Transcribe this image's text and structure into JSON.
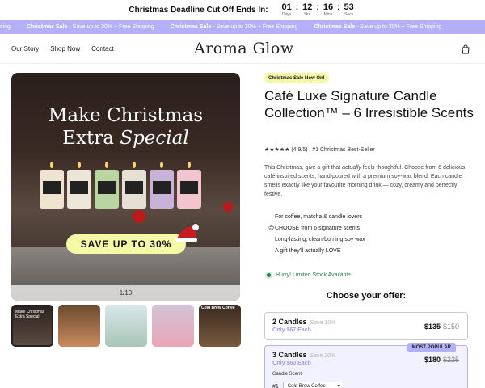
{
  "countdown": {
    "title": "Christmas Deadline Cut Off Ends In:",
    "days": "01",
    "hours": "12",
    "mins": "16",
    "secs": "53",
    "days_label": "Days",
    "hours_label": "Hrs",
    "mins_label": "Mins",
    "secs_label": "Secs"
  },
  "marquee": {
    "lead_fragment": "sing",
    "items": [
      {
        "bold": "Christmas Sale",
        "text": " - Save up to 30% + Free Shipping"
      },
      {
        "bold": "Christmas Sale",
        "text": " - Save up to 30% + Free Shipping"
      },
      {
        "bold": "Christmas Sale",
        "text": " - Save up to 30% + Free Shipping"
      }
    ]
  },
  "header": {
    "nav": [
      "Our Story",
      "Shop Now",
      "Contact"
    ],
    "logo": "Aroma Glow",
    "cart_icon": "bag-icon"
  },
  "gallery": {
    "hero_line1": "Make Christmas",
    "hero_line2_plain": "Extra ",
    "hero_line2_italic": "Special",
    "save_text": "SAVE UP TO 30%",
    "counter": "1/10",
    "thumb1_text": "Make Christmas Extra Special",
    "thumb5_label": "Cold Brew Coffee"
  },
  "product": {
    "badge": "Christmas Sale Now On!",
    "title": "Café Luxe Signature Candle Collection™ – 6 Irresistible Scents",
    "rating": "★★★★★ (4.9/5) | #1 Christmas Best-Seller",
    "desc_1": "This Christmas, give a gift that ",
    "desc_italic": "actually",
    "desc_2": " feels thoughtful. Choose from 6 delicious café-inspired scents, hand-poured with a premium soy-wax blend. Each candle smells exactly like your favourite morning drink — cozy, creamy and perfectly festive.",
    "features": [
      {
        "icon": "",
        "text": "For coffee, matcha & candle lovers"
      },
      {
        "icon": "😊",
        "text": "CHOOSE from 6 signature scents"
      },
      {
        "icon": "",
        "text": "Long-lasting, clean-burning soy wax"
      },
      {
        "icon": "",
        "text": "A gift they'll actually LOVE"
      }
    ],
    "stock": "Hurry! Limited Stock Available"
  },
  "offers": {
    "heading": "Choose your offer:",
    "items": [
      {
        "title": "2 Candles",
        "save": "Save 10%",
        "each": "Only $67 Each",
        "price": "$135",
        "was": "$150"
      },
      {
        "title": "3 Candles",
        "save": "Save 20%",
        "each": "Only $60 Each",
        "price": "$180",
        "was": "$225",
        "tag": "MOST POPULAR",
        "scent_label": "Candle Scent",
        "row_num": "#1",
        "select_value": "Cold Brew Coffee"
      }
    ]
  },
  "colors": {
    "accent": "#b4b0f7",
    "badge": "#f4f9a8",
    "stock": "#2e7d4f"
  }
}
